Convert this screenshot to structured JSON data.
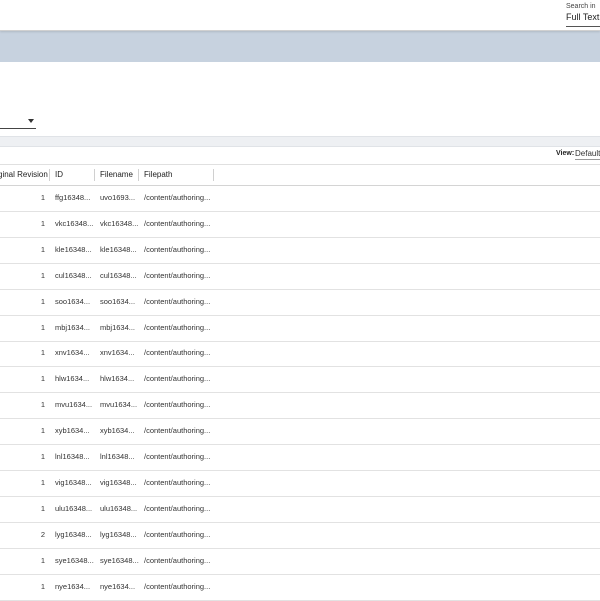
{
  "topbar": {
    "search_in_label": "Search in",
    "search_in_value": "Full Text"
  },
  "toolbar": {
    "view_label": "View:",
    "view_value": "Default"
  },
  "table": {
    "columns": [
      "ginal Revision",
      "ID",
      "Filename",
      "Filepath"
    ],
    "rows": [
      {
        "revision": "1",
        "id": "ffg16348...",
        "filename": "uvo1693...",
        "filepath": "/content/authoring..."
      },
      {
        "revision": "1",
        "id": "vkc16348...",
        "filename": "vkc16348...",
        "filepath": "/content/authoring..."
      },
      {
        "revision": "1",
        "id": "kle16348...",
        "filename": "kle16348...",
        "filepath": "/content/authoring..."
      },
      {
        "revision": "1",
        "id": "cul16348...",
        "filename": "cul16348...",
        "filepath": "/content/authoring..."
      },
      {
        "revision": "1",
        "id": "soo1634...",
        "filename": "soo1634...",
        "filepath": "/content/authoring..."
      },
      {
        "revision": "1",
        "id": "mbj1634...",
        "filename": "mbj1634...",
        "filepath": "/content/authoring..."
      },
      {
        "revision": "1",
        "id": "xnv1634...",
        "filename": "xnv1634...",
        "filepath": "/content/authoring..."
      },
      {
        "revision": "1",
        "id": "hlw1634...",
        "filename": "hlw1634...",
        "filepath": "/content/authoring..."
      },
      {
        "revision": "1",
        "id": "mvu1634...",
        "filename": "mvu1634...",
        "filepath": "/content/authoring..."
      },
      {
        "revision": "1",
        "id": "xyb1634...",
        "filename": "xyb1634...",
        "filepath": "/content/authoring..."
      },
      {
        "revision": "1",
        "id": "lnl16348...",
        "filename": "lnl16348...",
        "filepath": "/content/authoring..."
      },
      {
        "revision": "1",
        "id": "vig16348...",
        "filename": "vig16348...",
        "filepath": "/content/authoring..."
      },
      {
        "revision": "1",
        "id": "ulu16348...",
        "filename": "ulu16348...",
        "filepath": "/content/authoring..."
      },
      {
        "revision": "2",
        "id": "lyg16348...",
        "filename": "lyg16348...",
        "filepath": "/content/authoring..."
      },
      {
        "revision": "1",
        "id": "sye16348...",
        "filename": "sye16348...",
        "filepath": "/content/authoring..."
      },
      {
        "revision": "1",
        "id": "nye1634...",
        "filename": "nye1634...",
        "filepath": "/content/authoring..."
      }
    ]
  }
}
